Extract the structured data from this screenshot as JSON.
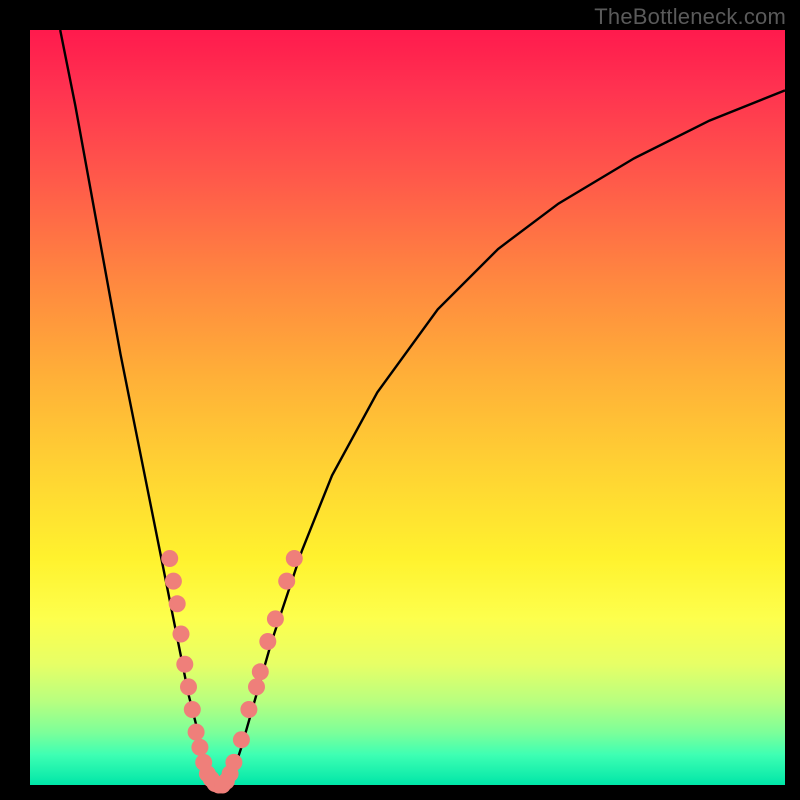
{
  "watermark": "TheBottleneck.com",
  "chart_data": {
    "type": "line",
    "title": "",
    "xlabel": "",
    "ylabel": "",
    "xlim": [
      0,
      100
    ],
    "ylim": [
      0,
      100
    ],
    "series": [
      {
        "name": "bottleneck-curve",
        "x": [
          4,
          6,
          8,
          10,
          12,
          14,
          16,
          18,
          20,
          21,
          22,
          23,
          24,
          25,
          26,
          27,
          28,
          30,
          32,
          36,
          40,
          46,
          54,
          62,
          70,
          80,
          90,
          100
        ],
        "y": [
          100,
          90,
          79,
          68,
          57,
          47,
          37,
          27,
          17,
          12,
          8,
          4,
          1,
          0,
          0,
          2,
          5,
          12,
          19,
          31,
          41,
          52,
          63,
          71,
          77,
          83,
          88,
          92
        ]
      }
    ],
    "markers": {
      "name": "highlight-dots",
      "color": "#ef7f7a",
      "points": [
        {
          "x": 18.5,
          "y": 30
        },
        {
          "x": 19.0,
          "y": 27
        },
        {
          "x": 19.5,
          "y": 24
        },
        {
          "x": 20.0,
          "y": 20
        },
        {
          "x": 20.5,
          "y": 16
        },
        {
          "x": 21.0,
          "y": 13
        },
        {
          "x": 21.5,
          "y": 10
        },
        {
          "x": 22.0,
          "y": 7
        },
        {
          "x": 22.5,
          "y": 5
        },
        {
          "x": 23.0,
          "y": 3
        },
        {
          "x": 23.5,
          "y": 1.5
        },
        {
          "x": 24.0,
          "y": 0.8
        },
        {
          "x": 24.5,
          "y": 0.2
        },
        {
          "x": 25.0,
          "y": 0
        },
        {
          "x": 25.5,
          "y": 0
        },
        {
          "x": 26.0,
          "y": 0.5
        },
        {
          "x": 26.5,
          "y": 1.5
        },
        {
          "x": 27.0,
          "y": 3
        },
        {
          "x": 28.0,
          "y": 6
        },
        {
          "x": 29.0,
          "y": 10
        },
        {
          "x": 30.0,
          "y": 13
        },
        {
          "x": 30.5,
          "y": 15
        },
        {
          "x": 31.5,
          "y": 19
        },
        {
          "x": 32.5,
          "y": 22
        },
        {
          "x": 34.0,
          "y": 27
        },
        {
          "x": 35.0,
          "y": 30
        }
      ]
    }
  },
  "colors": {
    "curve": "#000000",
    "marker": "#ef7f7a",
    "background_frame": "#000000"
  }
}
